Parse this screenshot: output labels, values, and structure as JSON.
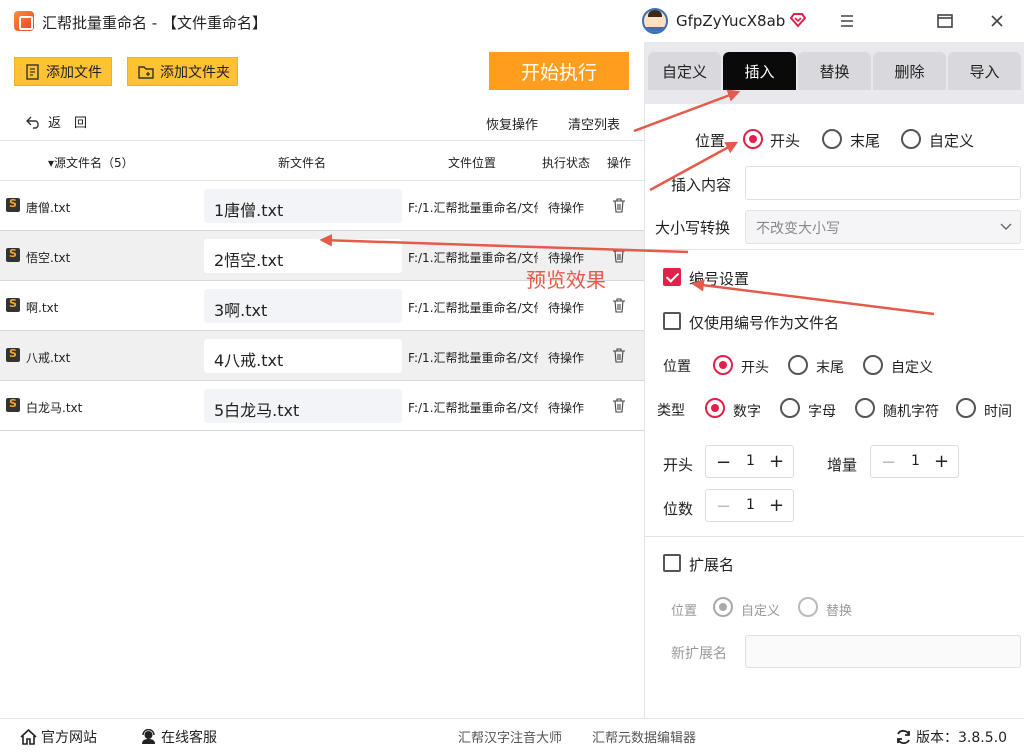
{
  "window": {
    "title": "汇帮批量重命名 - 【文件重命名】",
    "user_name": "GfpZyYucX8ab"
  },
  "toolbar": {
    "add_file": "添加文件",
    "add_folder": "添加文件夹",
    "start": "开始执行",
    "back": "返　回",
    "restore": "恢复操作",
    "clear": "清空列表"
  },
  "table": {
    "headers": {
      "source": "▾源文件名（5）",
      "new_name": "新文件名",
      "location": "文件位置",
      "status": "执行状态",
      "action": "操作"
    },
    "rows": [
      {
        "source": "唐僧.txt",
        "new_name": "1唐僧.txt",
        "path": "F:/1.汇帮批量重命名/文件",
        "status": "待操作"
      },
      {
        "source": "悟空.txt",
        "new_name": "2悟空.txt",
        "path": "F:/1.汇帮批量重命名/文件",
        "status": "待操作"
      },
      {
        "source": "啊.txt",
        "new_name": "3啊.txt",
        "path": "F:/1.汇帮批量重命名/文件",
        "status": "待操作"
      },
      {
        "source": "八戒.txt",
        "new_name": "4八戒.txt",
        "path": "F:/1.汇帮批量重命名/文件",
        "status": "待操作"
      },
      {
        "source": "白龙马.txt",
        "new_name": "5白龙马.txt",
        "path": "F:/1.汇帮批量重命名/文件",
        "status": "待操作"
      }
    ]
  },
  "tabs": [
    "自定义",
    "插入",
    "替换",
    "删除",
    "导入"
  ],
  "active_tab": "插入",
  "insert": {
    "position_label": "位置",
    "position_options": [
      "开头",
      "末尾",
      "自定义"
    ],
    "content_label": "插入内容",
    "content_value": "",
    "case_label": "大小写转换",
    "case_value": "不改变大小写",
    "numbering_label": "编号设置",
    "numbering_checked": true,
    "only_number_label": "仅使用编号作为文件名",
    "only_number_checked": false,
    "num_position_label": "位置",
    "num_position_options": [
      "开头",
      "末尾",
      "自定义"
    ],
    "type_label": "类型",
    "type_options": [
      "数字",
      "字母",
      "随机字符",
      "时间"
    ],
    "start_label": "开头",
    "start_value": "1",
    "increment_label": "增量",
    "increment_value": "1",
    "digits_label": "位数",
    "digits_value": "1",
    "ext_label": "扩展名",
    "ext_checked": false,
    "ext_position_label": "位置",
    "ext_position_options": [
      "自定义",
      "替换"
    ],
    "new_ext_label": "新扩展名",
    "new_ext_value": ""
  },
  "annotation": {
    "preview_text": "预览效果"
  },
  "footer": {
    "website": "官方网站",
    "support": "在线客服",
    "app1": "汇帮汉字注音大师",
    "app2": "汇帮元数据编辑器",
    "version": "版本：3.8.5.0"
  },
  "colors": {
    "accent": "#e2204a",
    "start_button": "#ff9d1e",
    "yellow_button": "#ffc233",
    "active_tab": "#0a0a0a",
    "annotation": "#e55a4a"
  }
}
